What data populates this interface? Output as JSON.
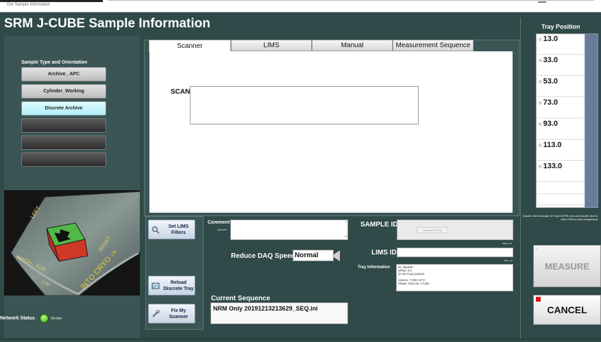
{
  "window": {
    "title": "Get Sample Information"
  },
  "app_title": "SRM J-CUBE Sample Information",
  "sample_type": {
    "label": "Sample Type and Orientation",
    "buttons": [
      "Archive_ APC",
      "Cylinder_Working",
      "Discrete Archive",
      "",
      "",
      ""
    ],
    "selected": "Discrete Archive"
  },
  "cube_image": {
    "labels": [
      "LEFT",
      "ARCH - TOP",
      "RIGHT",
      "INTO CRYO ->",
      "STM"
    ]
  },
  "network": {
    "label": "Network Status",
    "state": "On-line",
    "led_color": "#3aa816"
  },
  "tabs": [
    "Scanner",
    "LIMS",
    "Manual",
    "Measurement Sequence"
  ],
  "active_tab": "Scanner",
  "scanner": {
    "scan_label": "SCAN",
    "scan_value": ""
  },
  "side_buttons": {
    "set_lims": "Set LIMS Filters",
    "reload": "Reload Discrete Tray",
    "fix_scanner": "Fix My Scanner"
  },
  "comment": {
    "label": "Comment",
    "optional": "optional",
    "value": ""
  },
  "daq": {
    "label": "Reduce DAQ Speed",
    "value": "Normal"
  },
  "current_sequence": {
    "label": "Current Sequence",
    "value": "NRM Only 20191213213629_SEQ.ini"
  },
  "sample_id": {
    "label": "SAMPLE ID",
    "placeholder": "Sample ID Only",
    "sublabel": "label_id"
  },
  "lims_id": {
    "label": "LIMS ID",
    "sublabel": "lims_id"
  },
  "tray_info": {
    "label": "Tray Information",
    "lines": [
      "ID: tidpanl0",
      "Offset: 0.0",
      "@ 33.0 tray position",
      "",
      "Volume: 7.000 cm^3",
      "Shape: Discrete J-Cube"
    ]
  },
  "tray_position": {
    "title": "Tray Position",
    "items": [
      "13.0",
      "33.0",
      "53.0",
      "73.0",
      "93.0",
      "113.0",
      "133.0"
    ],
    "note": "Double click to assign ID Hold CNTRL key and double click to clear Click to view assignment"
  },
  "measure_label": "MEASURE",
  "cancel_label": "CANCEL"
}
